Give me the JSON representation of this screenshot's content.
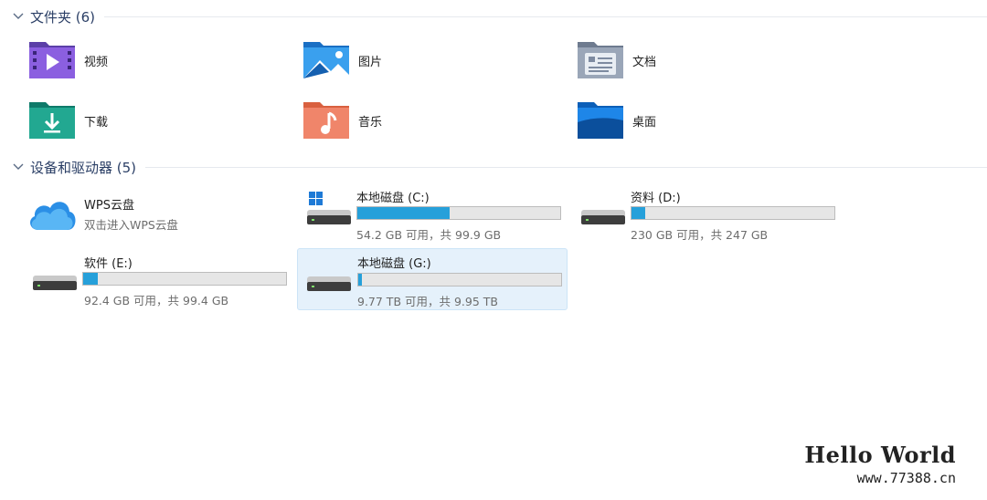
{
  "folders_section": {
    "title": "文件夹 (6)"
  },
  "folders": [
    {
      "label": "视频",
      "icon": "videos-folder-icon"
    },
    {
      "label": "图片",
      "icon": "pictures-folder-icon"
    },
    {
      "label": "文档",
      "icon": "documents-folder-icon"
    },
    {
      "label": "下载",
      "icon": "downloads-folder-icon"
    },
    {
      "label": "音乐",
      "icon": "music-folder-icon"
    },
    {
      "label": "桌面",
      "icon": "desktop-folder-icon"
    }
  ],
  "devices_section": {
    "title": "设备和驱动器 (5)"
  },
  "wps": {
    "name": "WPS云盘",
    "subtitle": "双击进入WPS云盘"
  },
  "drives": [
    {
      "name": "本地磁盘 (C:)",
      "info": "54.2 GB 可用，共 99.9 GB",
      "used_fraction": 0.457
    },
    {
      "name": "资料 (D:)",
      "info": "230 GB 可用，共 247 GB",
      "used_fraction": 0.069
    },
    {
      "name": "软件 (E:)",
      "info": "92.4 GB 可用，共 99.4 GB",
      "used_fraction": 0.07
    },
    {
      "name": "本地磁盘 (G:)",
      "info": "9.77 TB 可用，共 9.95 TB",
      "used_fraction": 0.018
    }
  ],
  "watermark": {
    "title": "Hello World",
    "url": "www.77388.cn"
  },
  "colors": {
    "accent": "#26a0da",
    "selected_bg": "#e5f1fb",
    "header_text": "#2b3f66"
  }
}
